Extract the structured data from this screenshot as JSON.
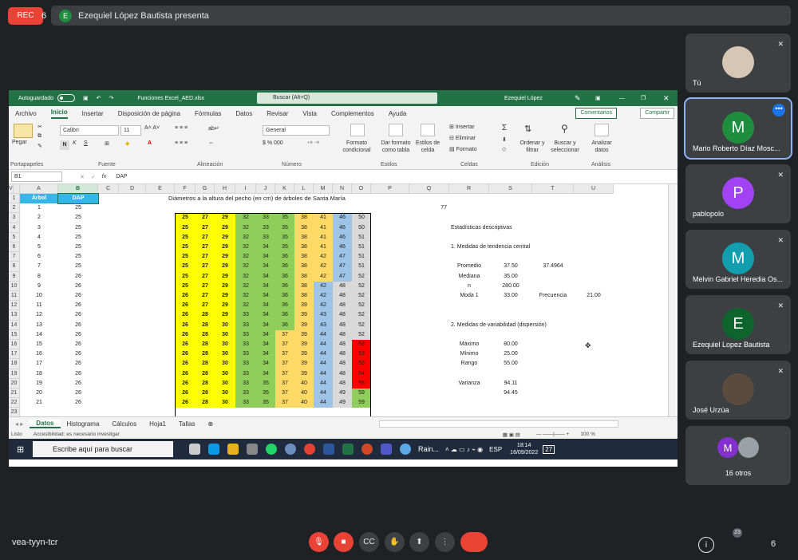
{
  "top": {
    "rec": "REC",
    "presenter_initial": "E",
    "presenter_text": "Ezequiel López Bautista presenta",
    "rec_glyph": "6"
  },
  "participants": [
    {
      "name": "Tú",
      "initial": "",
      "color": "#c9b9a8"
    },
    {
      "name": "Mario Roberto Díaz Mosc...",
      "initial": "M",
      "color": "#1e8e3e"
    },
    {
      "name": "pablopolo",
      "initial": "P",
      "color": "#a142f4"
    },
    {
      "name": "Melvin Gabriel Heredia Os...",
      "initial": "M",
      "color": "#129eaf"
    },
    {
      "name": "Ezequiel Lopez Bautista",
      "initial": "E",
      "color": "#0d652d"
    },
    {
      "name": "José Urzúa",
      "initial": "",
      "color": "#6d5c4c"
    },
    {
      "name": "16 otros",
      "initial": "M",
      "color": "#8430ce"
    }
  ],
  "excel": {
    "title": {
      "autosave": "Autoguardado",
      "file": "Funciones Excel_AED.xlsx",
      "search": "Buscar (Alt+Q)",
      "user": "Ezequiel López"
    },
    "tabs": [
      "Archivo",
      "Inicio",
      "Insertar",
      "Disposición de página",
      "Fórmulas",
      "Datos",
      "Revisar",
      "Vista",
      "Complementos",
      "Ayuda"
    ],
    "comments": "Comentarios",
    "share": "Compartir",
    "ribbon": {
      "paste": "Pegar",
      "font": "Calibri",
      "size": "11",
      "number_format": "General",
      "groups": [
        "Portapapeles",
        "Fuente",
        "Alineación",
        "Número",
        "Estilos",
        "Celdas",
        "Edición",
        "Análisis"
      ],
      "styles": [
        "Formato condicional",
        "Dar formato como tabla",
        "Estilos de celda"
      ],
      "cells": [
        "Insertar",
        "Eliminar",
        "Formato"
      ],
      "editing": [
        "Ordenar y filtrar",
        "Buscar y seleccionar"
      ],
      "analysis": "Analizar datos"
    },
    "namebox": "B1",
    "formula": "DAP",
    "columns": [
      "A",
      "B",
      "C",
      "D",
      "E",
      "F",
      "G",
      "H",
      "I",
      "J",
      "K",
      "L",
      "M",
      "N",
      "O",
      "P",
      "Q",
      "R",
      "S",
      "T",
      "U",
      "V"
    ],
    "sheet_title": "Diámetros a la altura del pecho (en cm) de árboles de Santa María",
    "header_a": "Árbol",
    "header_b": "DAP",
    "dap": [
      25,
      25,
      25,
      25,
      25,
      25,
      25,
      26,
      26,
      26,
      26,
      26,
      26,
      26,
      26,
      26,
      26,
      26,
      26,
      26,
      26
    ],
    "matrix": [
      [
        25,
        27,
        29,
        32,
        33,
        35,
        38,
        41,
        46,
        50
      ],
      [
        25,
        27,
        29,
        32,
        33,
        35,
        38,
        41,
        46,
        50
      ],
      [
        25,
        27,
        29,
        32,
        33,
        35,
        38,
        41,
        46,
        51
      ],
      [
        25,
        27,
        29,
        32,
        34,
        35,
        38,
        41,
        46,
        51
      ],
      [
        25,
        27,
        29,
        32,
        34,
        36,
        38,
        42,
        47,
        51
      ],
      [
        25,
        27,
        29,
        32,
        34,
        36,
        38,
        42,
        47,
        51
      ],
      [
        25,
        27,
        29,
        32,
        34,
        36,
        38,
        42,
        47,
        52
      ],
      [
        25,
        27,
        29,
        32,
        34,
        36,
        38,
        42,
        48,
        52
      ],
      [
        26,
        27,
        29,
        32,
        34,
        36,
        38,
        42,
        48,
        52
      ],
      [
        26,
        27,
        29,
        32,
        34,
        36,
        39,
        42,
        48,
        52
      ],
      [
        26,
        28,
        29,
        33,
        34,
        36,
        39,
        43,
        48,
        52
      ],
      [
        26,
        28,
        30,
        33,
        34,
        36,
        39,
        43,
        48,
        52
      ],
      [
        26,
        28,
        30,
        33,
        34,
        37,
        39,
        44,
        48,
        52
      ],
      [
        26,
        28,
        30,
        33,
        34,
        37,
        39,
        44,
        48,
        53
      ],
      [
        26,
        28,
        30,
        33,
        34,
        37,
        39,
        44,
        48,
        53
      ],
      [
        26,
        28,
        30,
        33,
        34,
        37,
        39,
        44,
        48,
        53
      ],
      [
        26,
        28,
        30,
        33,
        34,
        37,
        39,
        44,
        48,
        54
      ],
      [
        26,
        28,
        30,
        33,
        35,
        37,
        40,
        44,
        48,
        56
      ],
      [
        26,
        28,
        30,
        33,
        35,
        37,
        40,
        44,
        49,
        59
      ],
      [
        26,
        28,
        30,
        33,
        35,
        37,
        40,
        44,
        49,
        59
      ]
    ],
    "q2": "77",
    "stats": {
      "title": "Estadísticas descriptivas",
      "sec1": "1. Medidas de tendencia central",
      "promedio_l": "Promedio",
      "promedio": "37.50",
      "promedio_exact": "37.4964",
      "mediana_l": "Mediana",
      "mediana": "35.00",
      "n_l": "n",
      "n": "280.00",
      "moda_l": "Moda 1",
      "moda": "33.00",
      "frec_l": "Frecuencia",
      "frec": "21.00",
      "sec2": "2. Medidas de variabilidad (dispersión)",
      "max_l": "Máximo",
      "max": "80.00",
      "min_l": "Mínimo",
      "min": "25.00",
      "rango_l": "Rango",
      "rango": "55.00",
      "var_l": "Varianza",
      "var": "94.11",
      "var2": "94.45"
    },
    "sheets": [
      "Datos",
      "Histograma",
      "Cálculos",
      "Hoja1",
      "Tallas"
    ],
    "status_ready": "Listo",
    "status_acc": "Accesibilidad: es necesario investigar",
    "zoom": "100 %"
  },
  "taskbar": {
    "search": "Escribe aquí para buscar",
    "weather": "Rain...",
    "lang": "ESP",
    "time": "18:14",
    "date": "16/09/2022",
    "notif": "27"
  },
  "bottom": {
    "code": "vea-tyyn-tcr",
    "count": "23",
    "glyph": "6"
  }
}
